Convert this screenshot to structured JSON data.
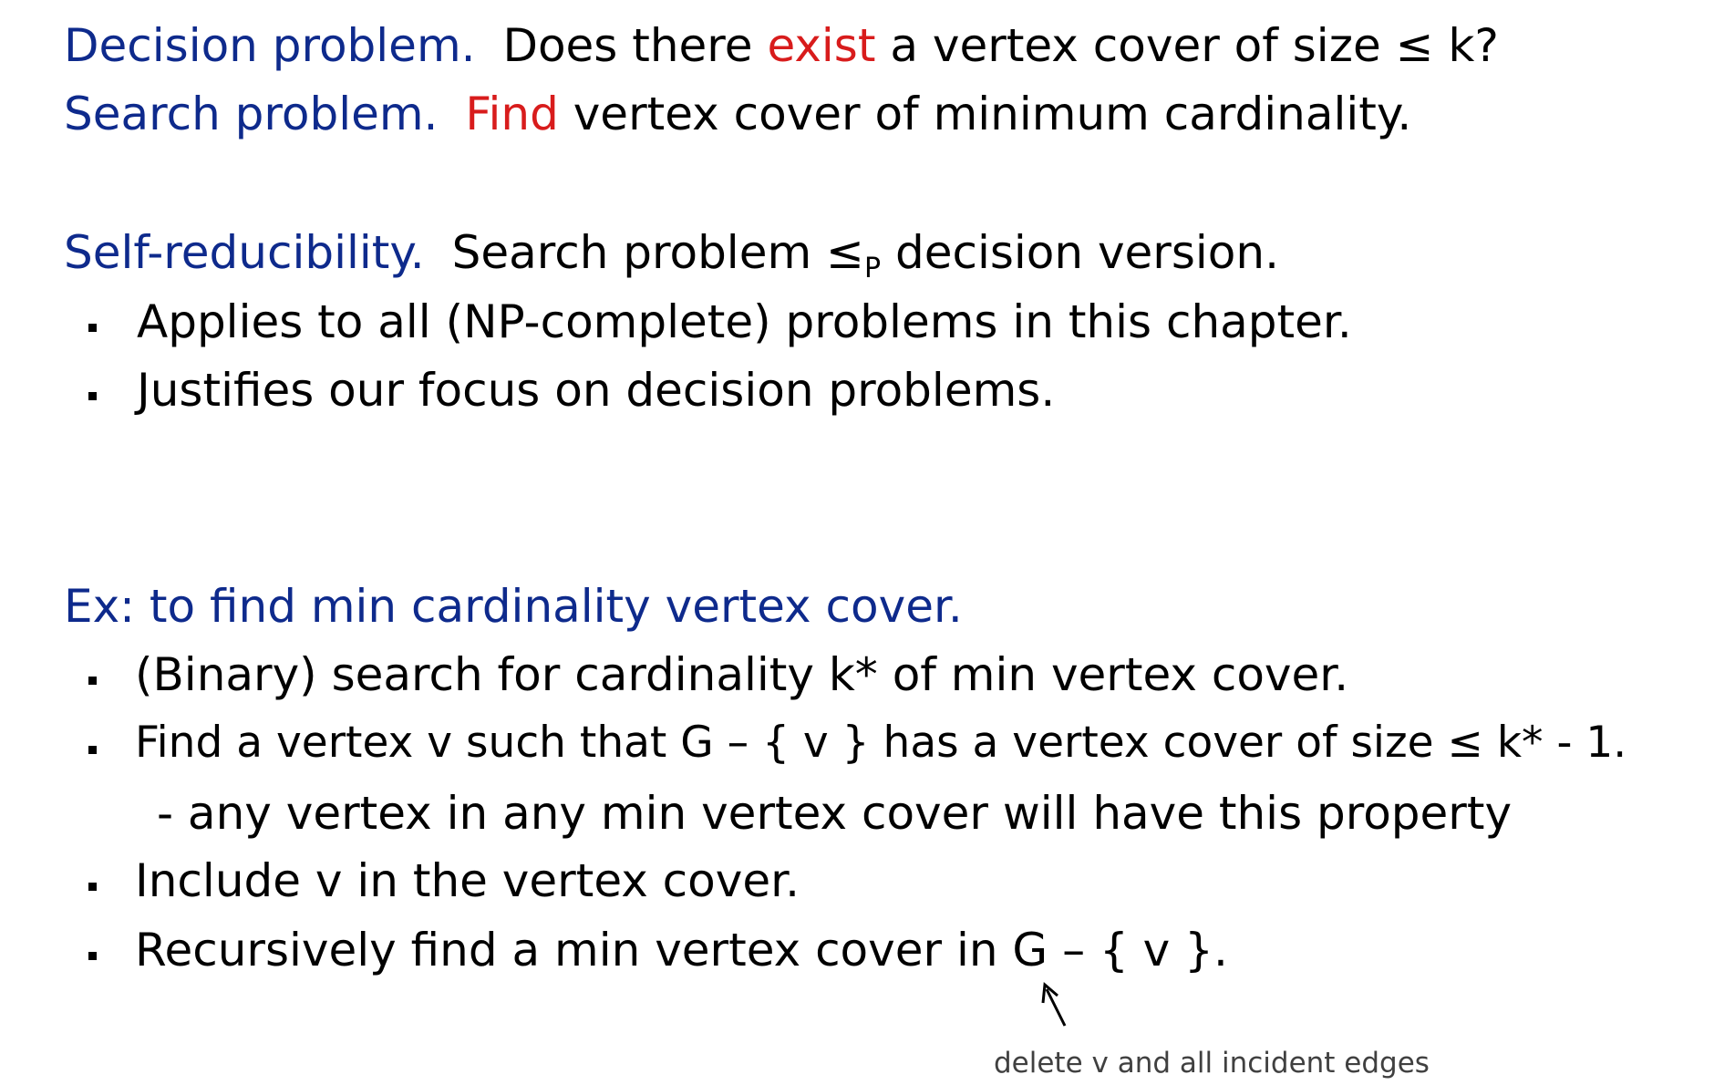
{
  "decision": {
    "label": "Decision problem.",
    "pre": "Does there",
    "key": "exist",
    "post": "a vertex cover of size ≤ k?"
  },
  "search": {
    "label": "Search problem.",
    "key": "Find",
    "post": "vertex cover of minimum cardinality."
  },
  "self_reducibility": {
    "label": "Self-reducibility.",
    "pre": "Search problem ≤",
    "sub": "P",
    "post": "decision version.",
    "bullets": [
      "Applies to all (NP-complete) problems in this chapter.",
      "Justifies our focus on decision problems."
    ]
  },
  "example": {
    "label": "Ex:  to find min cardinality vertex cover.",
    "bullets": [
      "(Binary) search for cardinality k* of min vertex cover.",
      "Find a vertex v such that G – { v } has a vertex cover of size ≤ k* - 1.",
      "Include v in the vertex cover.",
      "Recursively find a min vertex cover in G – { v }."
    ],
    "sub_bullet": "- any vertex in any min vertex cover will have this property",
    "annotation": "delete v and all incident edges"
  },
  "colors": {
    "heading_blue": "#0e2a8c",
    "emphasis_red": "#d81c1c",
    "text": "#000000",
    "annotation_gray": "#404040"
  }
}
